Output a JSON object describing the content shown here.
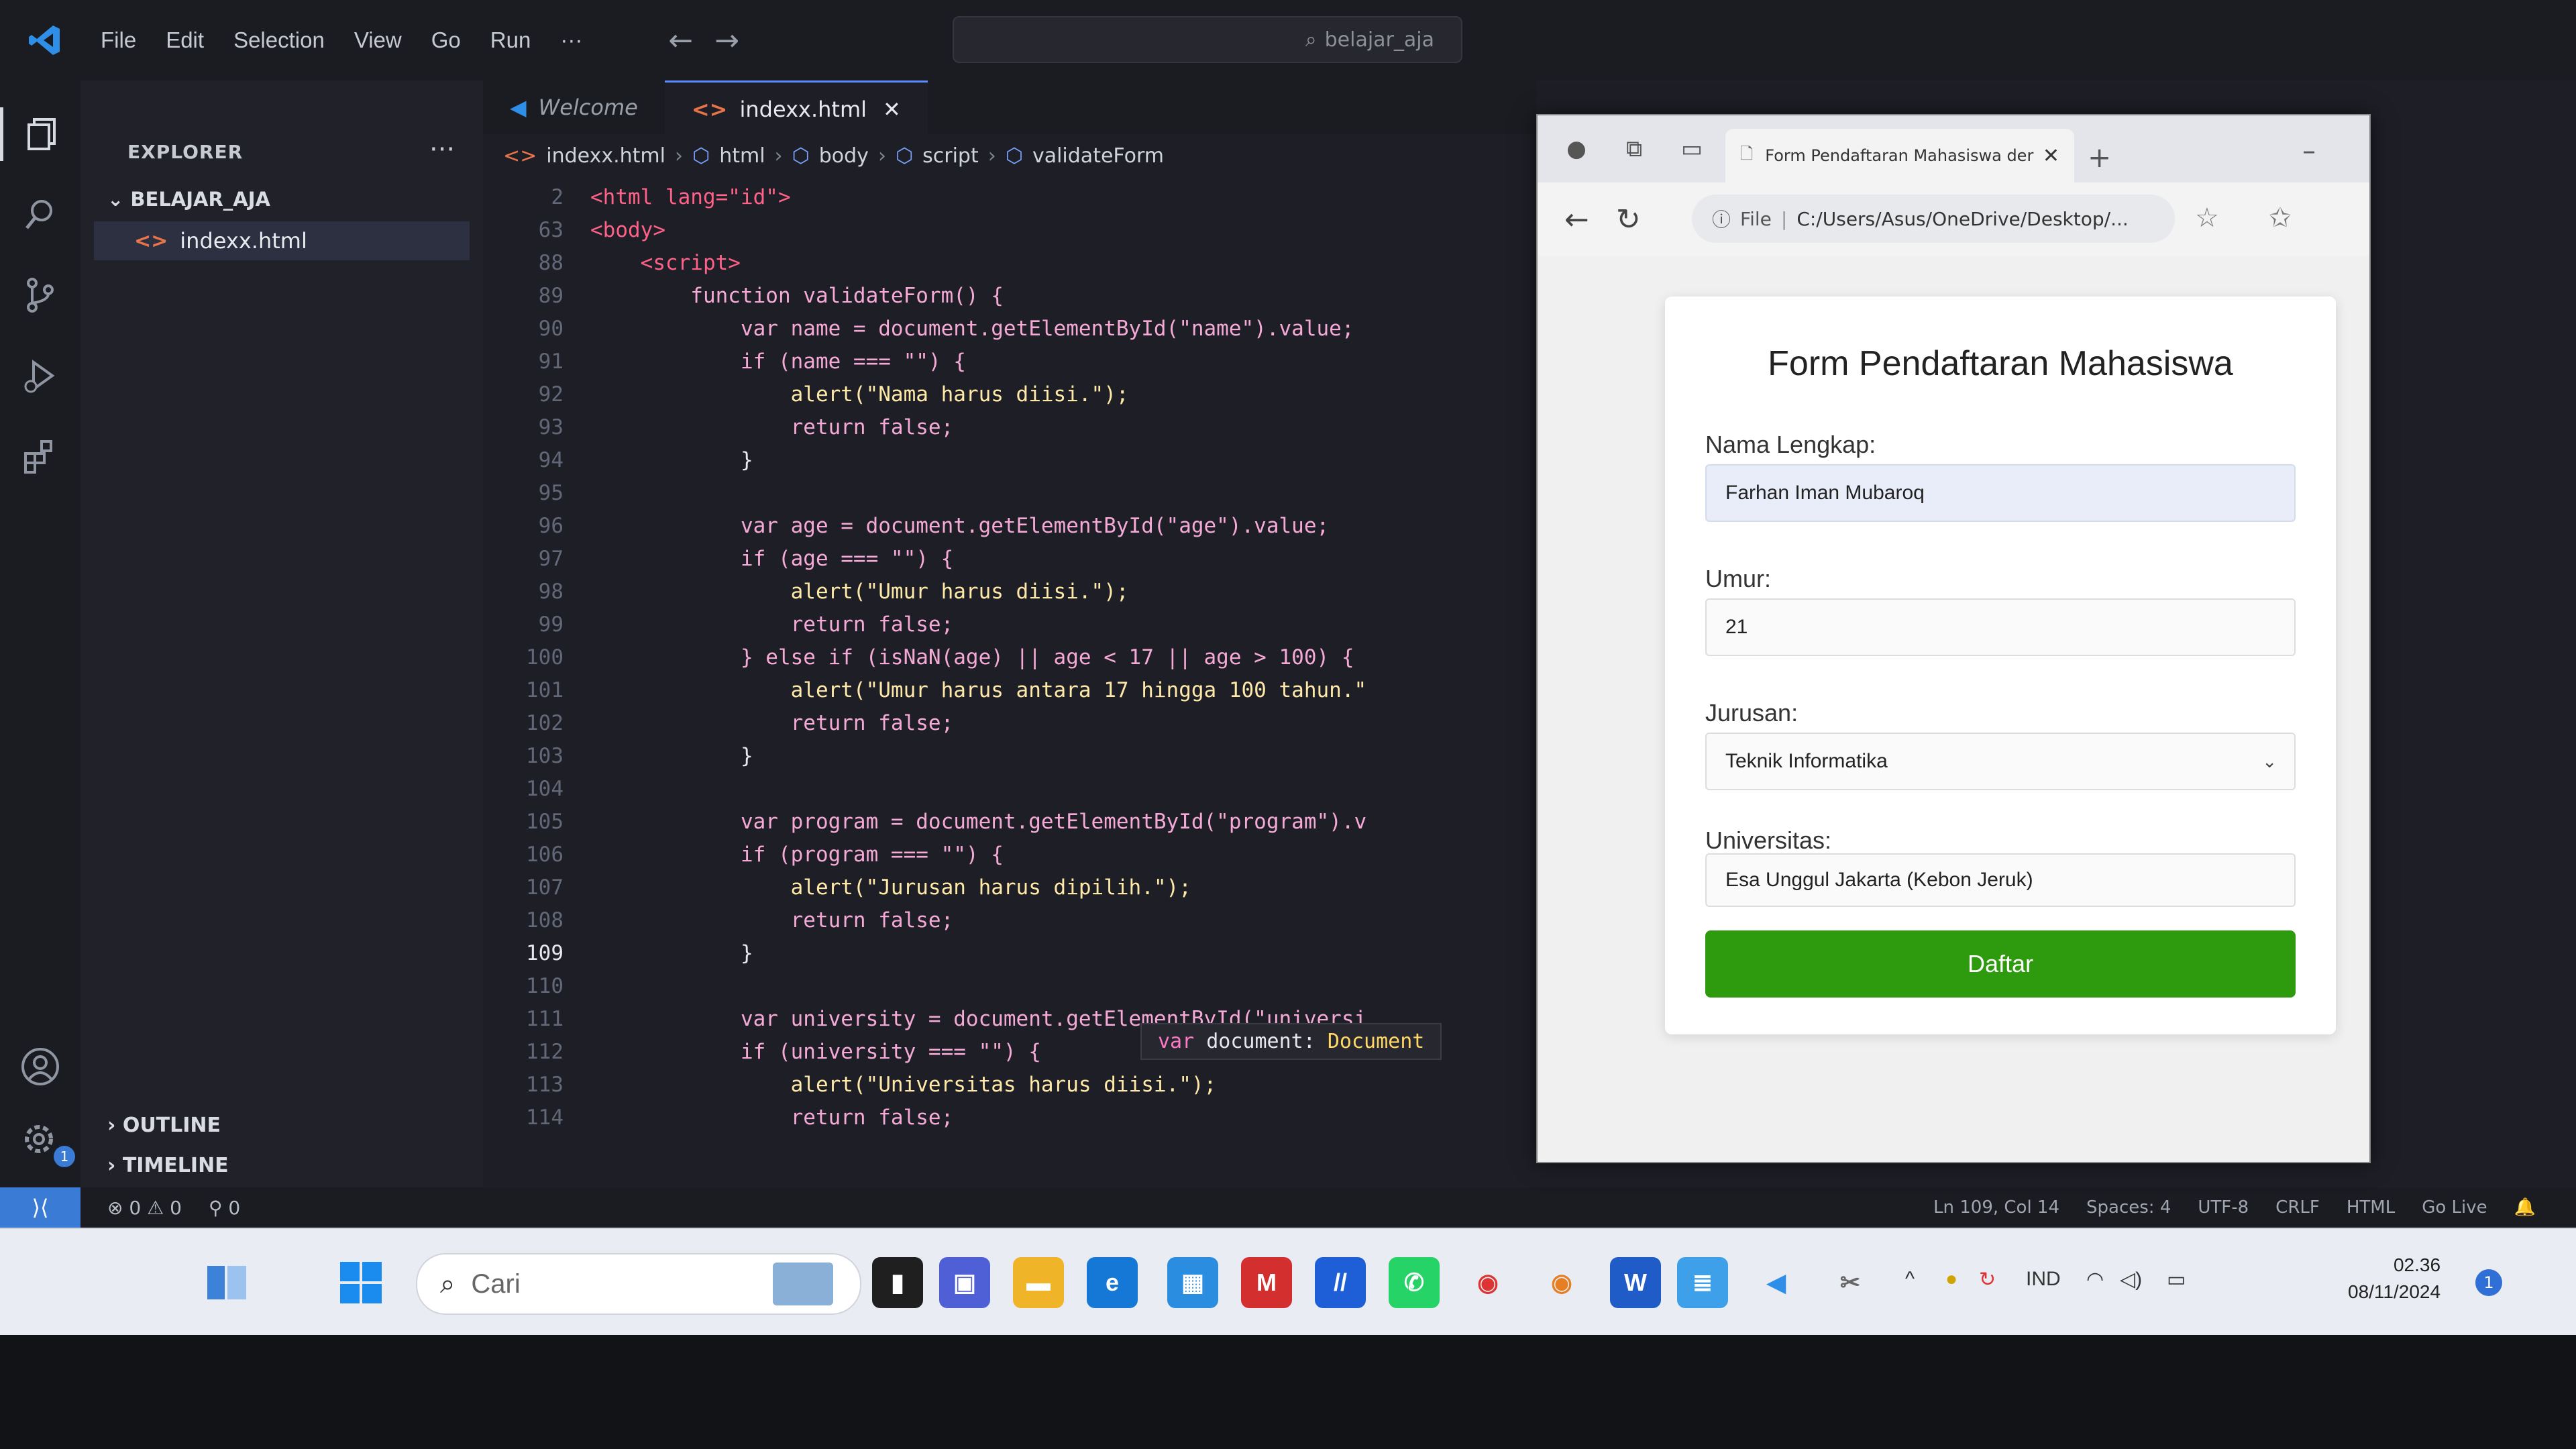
{
  "vscode": {
    "menu": [
      "File",
      "Edit",
      "Selection",
      "View",
      "Go",
      "Run",
      "···"
    ],
    "search_text": "belajar_aja",
    "explorer_title": "EXPLORER",
    "folder": "BELAJAR_AJA",
    "file": "indexx.html",
    "tabs": [
      {
        "label": "Welcome"
      },
      {
        "label": "indexx.html"
      }
    ],
    "breadcrumb": [
      "indexx.html",
      "html",
      "body",
      "script",
      "validateForm"
    ],
    "outline_label": "OUTLINE",
    "timeline_label": "TIMELINE",
    "settings_badge": "1",
    "tooltip": {
      "keyword": "var",
      "name": "document:",
      "type": "Document"
    },
    "code_lines": [
      {
        "num": "2",
        "text": "<html lang=\"id\">"
      },
      {
        "num": "63",
        "text": "<body>"
      },
      {
        "num": "88",
        "text": "    <script>"
      },
      {
        "num": "89",
        "text": "        function validateForm() {"
      },
      {
        "num": "90",
        "text": "            var name = document.getElementById(\"name\").value;"
      },
      {
        "num": "91",
        "text": "            if (name === \"\") {"
      },
      {
        "num": "92",
        "text": "                alert(\"Nama harus diisi.\");"
      },
      {
        "num": "93",
        "text": "                return false;"
      },
      {
        "num": "94",
        "text": "            }"
      },
      {
        "num": "95",
        "text": ""
      },
      {
        "num": "96",
        "text": "            var age = document.getElementById(\"age\").value;"
      },
      {
        "num": "97",
        "text": "            if (age === \"\") {"
      },
      {
        "num": "98",
        "text": "                alert(\"Umur harus diisi.\");"
      },
      {
        "num": "99",
        "text": "                return false;"
      },
      {
        "num": "100",
        "text": "            } else if (isNaN(age) || age < 17 || age > 100) {"
      },
      {
        "num": "101",
        "text": "                alert(\"Umur harus antara 17 hingga 100 tahun.\""
      },
      {
        "num": "102",
        "text": "                return false;"
      },
      {
        "num": "103",
        "text": "            }"
      },
      {
        "num": "104",
        "text": ""
      },
      {
        "num": "105",
        "text": "            var program = document.getElementById(\"program\").v"
      },
      {
        "num": "106",
        "text": "            if (program === \"\") {"
      },
      {
        "num": "107",
        "text": "                alert(\"Jurusan harus dipilih.\");"
      },
      {
        "num": "108",
        "text": "                return false;"
      },
      {
        "num": "109",
        "text": "            }"
      },
      {
        "num": "110",
        "text": ""
      },
      {
        "num": "111",
        "text": "            var university = document.getElementById(\"universi"
      },
      {
        "num": "112",
        "text": "            if (university === \"\") {"
      },
      {
        "num": "113",
        "text": "                alert(\"Universitas harus diisi.\");"
      },
      {
        "num": "114",
        "text": "                return false;"
      }
    ],
    "current_line": "109",
    "status": {
      "errors": "0",
      "warnings": "0",
      "ports": "0",
      "position": "Ln 109, Col 14",
      "spaces": "Spaces: 4",
      "encoding": "UTF-8",
      "eol": "CRLF",
      "language": "HTML",
      "golive": "Go Live"
    }
  },
  "browser": {
    "tab_title": "Form Pendaftaran Mahasiswa der",
    "url_label": "File",
    "url": "C:/Users/Asus/OneDrive/Desktop/...",
    "form": {
      "title": "Form Pendaftaran Mahasiswa",
      "name_label": "Nama Lengkap:",
      "name_value": "Farhan Iman Mubaroq",
      "age_label": "Umur:",
      "age_value": "21",
      "program_label": "Jurusan:",
      "program_value": "Teknik Informatika",
      "university_label": "Universitas:",
      "university_value": "Esa Unggul Jakarta (Kebon Jeruk)",
      "submit_label": "Daftar"
    }
  },
  "taskbar": {
    "search_placeholder": "Cari",
    "language": "IND",
    "time": "02.36",
    "date": "08/11/2024",
    "notification_count": "1",
    "colors": {
      "vscode_blue": "#3a7bd5",
      "submit_green": "#2e9a0e"
    }
  }
}
